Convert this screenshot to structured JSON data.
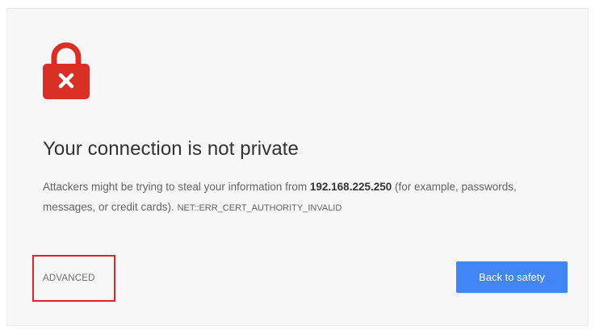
{
  "interstitial": {
    "title": "Your connection is not private",
    "desc_before": "Attackers might be trying to steal your information from ",
    "host": "192.168.225.250",
    "desc_after": " (for example, passwords, messages, or credit cards). ",
    "error_code": "NET::ERR_CERT_AUTHORITY_INVALID",
    "lock_icon": "lock-error-icon",
    "lock_color": "#d93025"
  },
  "actions": {
    "advanced_label": "ADVANCED",
    "back_label": "Back to safety",
    "back_color": "#4285f4",
    "highlight_color": "#e5202a"
  }
}
